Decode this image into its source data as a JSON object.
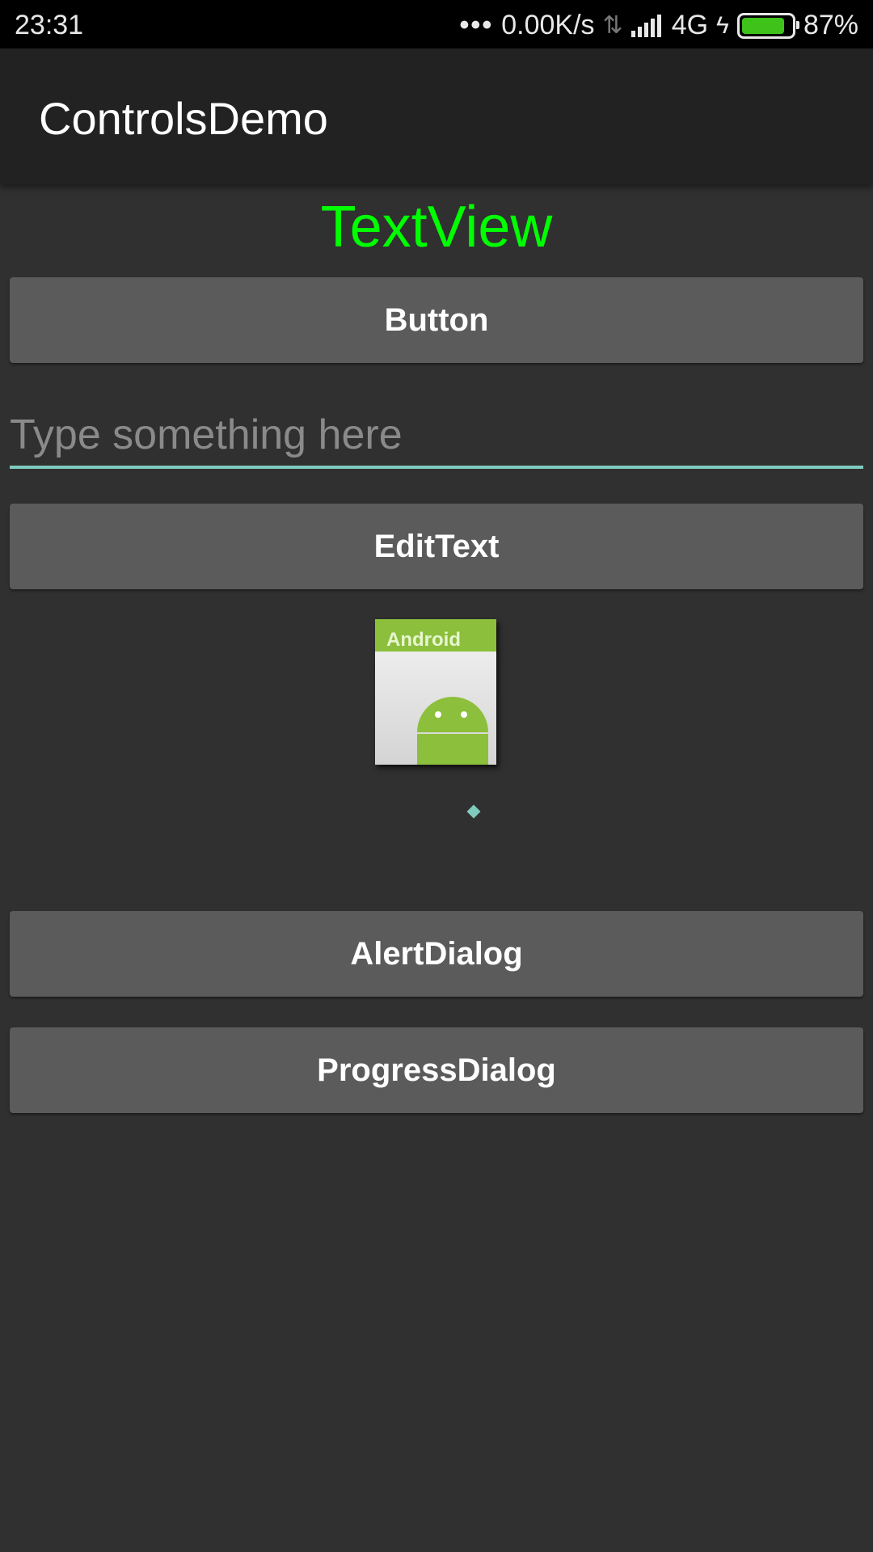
{
  "status_bar": {
    "time": "23:31",
    "dots": "•••",
    "net_speed": "0.00K/s",
    "network": "4G",
    "battery_percent": "87%",
    "battery_level": 0.87,
    "battery_color": "#3fc21a"
  },
  "app_bar": {
    "title": "ControlsDemo"
  },
  "content": {
    "textview": "TextView",
    "textview_color": "#00ff00",
    "button_label": "Button",
    "edit_placeholder": "Type something here",
    "edittext_button_label": "EditText",
    "image_label": "Android",
    "alert_button_label": "AlertDialog",
    "progress_button_label": "ProgressDialog",
    "accent_color": "#7fcbbe"
  }
}
